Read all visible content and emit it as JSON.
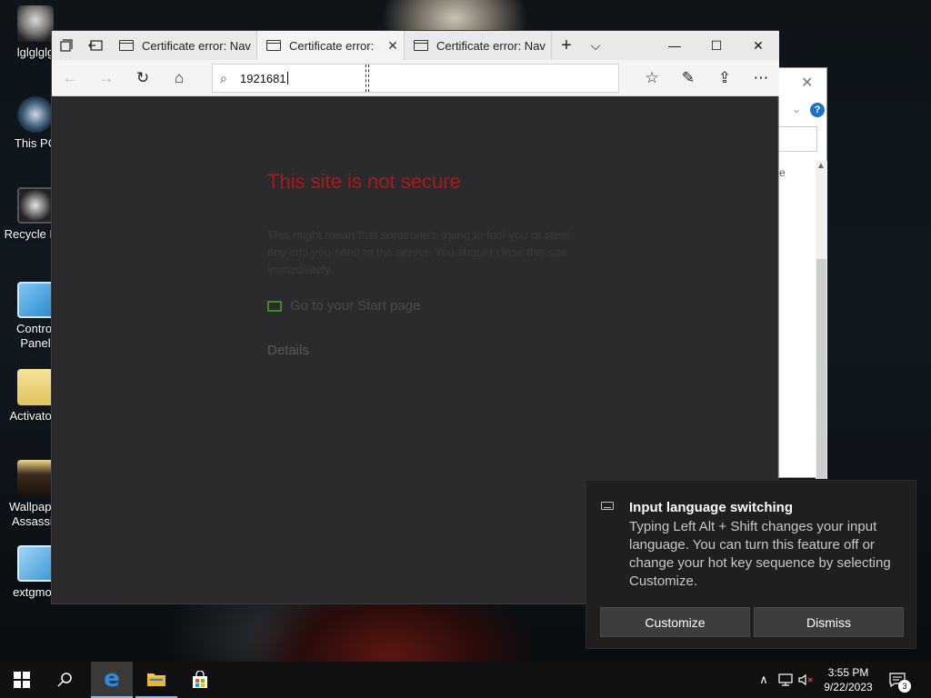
{
  "desktop": {
    "icons": [
      {
        "label": "lglglglg"
      },
      {
        "label": "This PC"
      },
      {
        "label": "Recycle Bin"
      },
      {
        "label": "Control\nPanel"
      },
      {
        "label": "Activators"
      },
      {
        "label": "Wallpaper\nAssassin"
      },
      {
        "label": "extgmod"
      }
    ]
  },
  "browser": {
    "tabs": [
      {
        "title": "Certificate error: Nav",
        "active": false
      },
      {
        "title": "Certificate error:",
        "active": true
      },
      {
        "title": "Certificate error: Nav",
        "active": false
      }
    ],
    "address": {
      "value": "1921681"
    },
    "error_page": {
      "title": "This site is not secure",
      "body": "This might mean that someone's trying to fool you or steal any info you send to the server. You should close this site immediately.",
      "start_link": "Go to your Start page",
      "details": "Details"
    }
  },
  "toast": {
    "title": "Input language switching",
    "body": "Typing Left Alt + Shift changes your input language. You can turn this feature off or change your hot key sequence by selecting Customize.",
    "customize": "Customize",
    "dismiss": "Dismiss"
  },
  "taskbar": {
    "time": "3:55 PM",
    "date": "9/22/2023",
    "notification_count": "3"
  },
  "colors": {
    "error_title": "#a8191c",
    "accent": "#1e73c9"
  }
}
